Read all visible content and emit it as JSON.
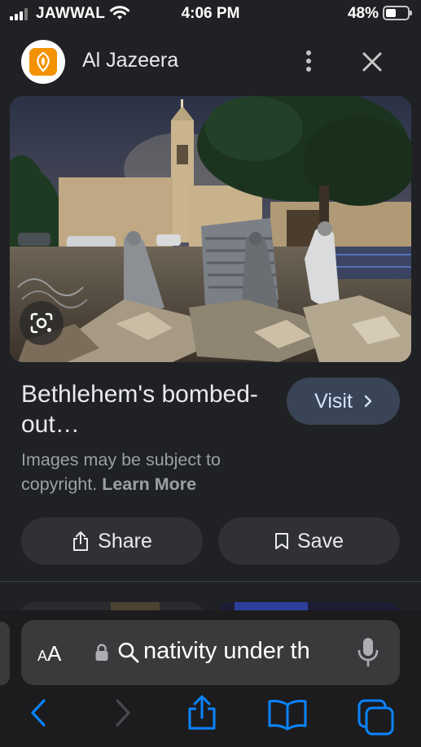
{
  "status_bar": {
    "carrier": "JAWWAL",
    "time": "4:06 PM",
    "battery_percent": "48%",
    "battery_level": 0.48
  },
  "header": {
    "site_name": "Al Jazeera"
  },
  "result": {
    "title": "Bethlehem's bombed-out…",
    "visit_label": "Visit",
    "copyright_text": "Images may be subject to copyright.",
    "learn_more": "Learn More"
  },
  "actions": {
    "share_label": "Share",
    "save_label": "Save"
  },
  "browser": {
    "text_size_label_big": "A",
    "text_size_label_small": "A",
    "address_text": "nativity under th"
  },
  "colors": {
    "background": "#202124",
    "accent_button": "#394457",
    "accent_text": "#d2e3fc",
    "safari_blue": "#0a84ff",
    "aljazeera_orange": "#f39200"
  }
}
